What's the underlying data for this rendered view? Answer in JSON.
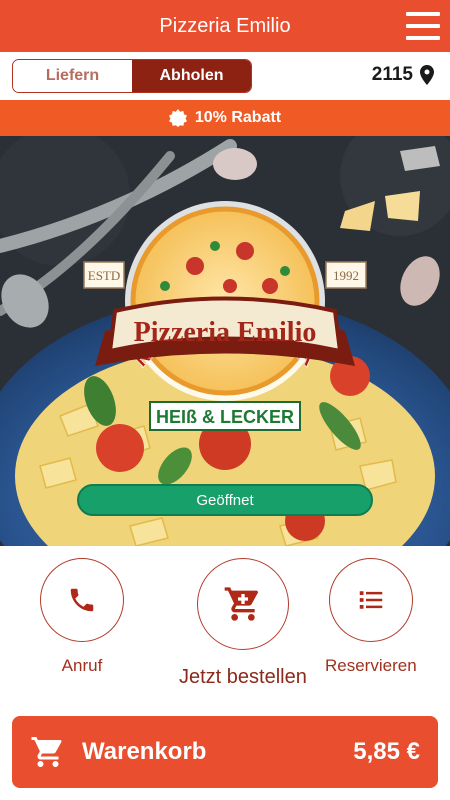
{
  "header": {
    "title": "Pizzeria Emilio",
    "menu_icon": "hamburger-menu-icon"
  },
  "mode": {
    "options": [
      "Liefern",
      "Abholen"
    ],
    "selected": "Abholen"
  },
  "location": {
    "zip": "2115",
    "icon": "location-pin-icon"
  },
  "discount": {
    "text": "10% Rabatt",
    "icon": "badge-icon"
  },
  "hero": {
    "logo": {
      "top_text": "PREMIUM QUALITÄT",
      "estd_left": "ESTD",
      "estd_right": "1992",
      "name": "Pizzeria Emilio",
      "tagline": "HEIß & LECKER"
    },
    "status_button": "Geöffnet"
  },
  "actions": [
    {
      "label": "Anruf",
      "icon": "phone-icon"
    },
    {
      "label": "Jetzt bestellen",
      "icon": "cart-icon"
    },
    {
      "label": "Reservieren",
      "icon": "list-icon"
    }
  ],
  "cart": {
    "label": "Warenkorb",
    "total": "5,85 €",
    "icon": "shopping-cart-icon"
  },
  "colors": {
    "primary": "#e94e2e",
    "dark": "#8d2213",
    "discount": "#f05a24",
    "open": "#17a06a"
  }
}
